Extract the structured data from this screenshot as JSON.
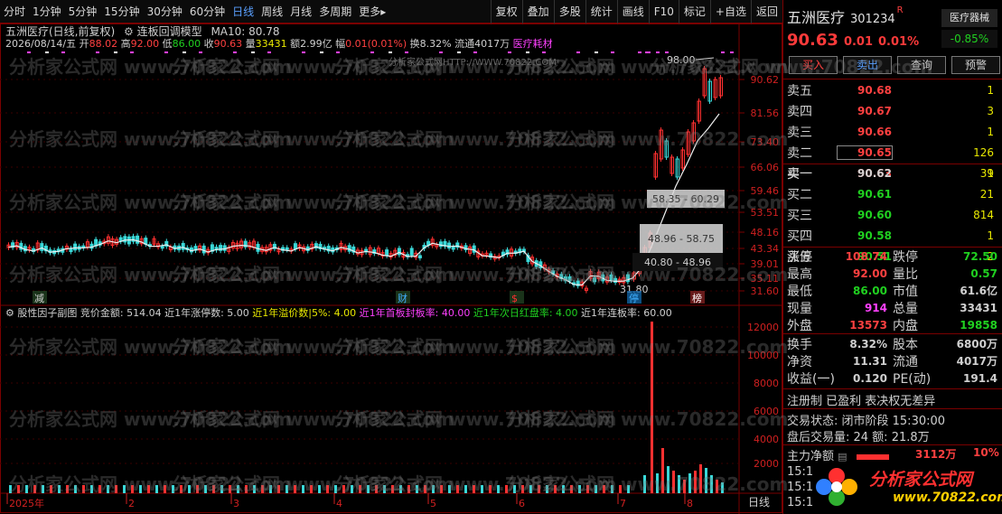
{
  "toolbar": {
    "left": [
      "分时",
      "1分钟",
      "5分钟",
      "15分钟",
      "30分钟",
      "60分钟",
      "日线",
      "周线",
      "月线",
      "多周期",
      "更多▸"
    ],
    "active_index": 6,
    "right": [
      "复权",
      "叠加",
      "多股",
      "统计",
      "画线",
      "F10",
      "标记",
      "+自选",
      "返回"
    ]
  },
  "info": {
    "stock_title": "五洲医疗(日线,前复权)",
    "indicator": "连板回调模型",
    "ma10": "MA10: 80.78",
    "date": "2026/08/14/五",
    "open_l": "开",
    "open": "88.02",
    "high_l": "高",
    "high": "92.00",
    "low_l": "低",
    "low": "86.00",
    "close_l": "收",
    "close": "90.63",
    "vol_l": "量",
    "vol": "33431",
    "amt_l": "额",
    "amt": "2.99亿",
    "chg_l": "幅",
    "chg": "0.01(0.01%)",
    "turn": "换8.32%",
    "float": "流通4017万",
    "sector": "医疗耗材",
    "sub_title": "股性因子副图",
    "f1": "竞价金额: 514.04",
    "f2": "近1年涨停数: 5.00",
    "f3": "近1年溢价数|5%: 4.00",
    "f4": "近1年首板封板率: 40.00",
    "f5": "近1年次日红盘率: 4.00",
    "f6": "近1年连板率: 60.00"
  },
  "chart": {
    "price_axis": [
      "90.62",
      "81.56",
      "73.40",
      "66.06",
      "59.46",
      "53.51",
      "48.16",
      "43.34",
      "39.01",
      "35.11",
      "31.60"
    ],
    "vol_axis": [
      "12000",
      "10000",
      "8000",
      "6000",
      "4000",
      "2000"
    ],
    "zones": [
      "58.35 - 60.29",
      "48.96 - 58.75",
      "40.80 - 48.96"
    ],
    "high_mark": "98.00",
    "low_mark": "31.80",
    "markers": [
      "减",
      "财",
      "$",
      "停",
      "榜"
    ],
    "time_labels": [
      "2025年",
      "2",
      "3",
      "4",
      "5",
      "6",
      "7",
      "8"
    ],
    "period": "日线",
    "center_watermark": "分析家公式网HTTP://WWW.70822.COM"
  },
  "watermark": "分析家公式网 www.70822.com",
  "quote": {
    "name": "五洲医疗",
    "code": "301234",
    "r_flag": "R",
    "industry": "医疗器械",
    "industry_chg": "-0.85%",
    "price": "90.63",
    "change": "0.01",
    "pct": "0.01%",
    "buttons": [
      "买入",
      "卖出",
      "查询",
      "预警"
    ],
    "asks": [
      {
        "label": "卖五",
        "price": "90.68",
        "vol": "1"
      },
      {
        "label": "卖四",
        "price": "90.67",
        "vol": "3"
      },
      {
        "label": "卖三",
        "price": "90.66",
        "vol": "1"
      },
      {
        "label": "卖二",
        "price": "90.65",
        "vol": "126"
      },
      {
        "label": "卖一",
        "price": "90.63",
        "vol": "1"
      }
    ],
    "bids": [
      {
        "label": "买一",
        "price": "90.62",
        "vol": "39"
      },
      {
        "label": "买二",
        "price": "90.61",
        "vol": "21"
      },
      {
        "label": "买三",
        "price": "90.60",
        "vol": "814"
      },
      {
        "label": "买四",
        "price": "90.58",
        "vol": "1"
      },
      {
        "label": "买五",
        "price": "90.51",
        "vol": "2"
      }
    ],
    "stats1": [
      {
        "l1": "涨停",
        "v1": "108.74",
        "c1": "#ff4040",
        "l2": "跌停",
        "v2": "72.50",
        "c2": "#20d020"
      },
      {
        "l1": "最高",
        "v1": "92.00",
        "c1": "#ff4040",
        "l2": "量比",
        "v2": "0.57",
        "c2": "#20d020"
      },
      {
        "l1": "最低",
        "v1": "86.00",
        "c1": "#20d020",
        "l2": "市值",
        "v2": "61.6亿",
        "c2": "#d0d0d0"
      },
      {
        "l1": "现量",
        "v1": "914",
        "c1": "#ff40ff",
        "l2": "总量",
        "v2": "33431",
        "c2": "#d0d0d0"
      },
      {
        "l1": "外盘",
        "v1": "13573",
        "c1": "#ff4040",
        "l2": "内盘",
        "v2": "19858",
        "c2": "#20d020"
      }
    ],
    "stats2": [
      {
        "l1": "换手",
        "v1": "8.32%",
        "c1": "#d0d0d0",
        "l2": "股本",
        "v2": "6800万",
        "c2": "#d0d0d0"
      },
      {
        "l1": "净资",
        "v1": "11.31",
        "c1": "#d0d0d0",
        "l2": "流通",
        "v2": "4017万",
        "c2": "#d0d0d0"
      },
      {
        "l1": "收益(一)",
        "v1": "0.120",
        "c1": "#d0d0d0",
        "l2": "PE(动)",
        "v2": "191.4",
        "c2": "#d0d0d0"
      }
    ],
    "reg": "注册制 已盈利 表决权无差异",
    "trade_state": "交易状态: 闭市阶段 15:30:00",
    "after_trade": "盘后交易量: 24  额: 21.8万",
    "main_flow_l": "主力净额",
    "main_flow": "3112万",
    "main_pct": "10%",
    "times": [
      "15:1",
      "15:1",
      "15:1"
    ],
    "logo": "分析家公式网",
    "logo_url": "www.70822.com"
  }
}
